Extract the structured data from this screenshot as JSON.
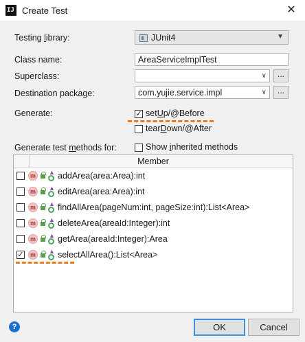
{
  "window": {
    "title": "Create Test",
    "app_icon_text": "IJ",
    "close_glyph": "✕"
  },
  "form": {
    "testing_library_label": "Testing library:",
    "testing_library_value": "JUnit4",
    "class_name_label": "Class name:",
    "class_name_value": "AreaServiceImplTest",
    "superclass_label": "Superclass:",
    "superclass_value": "",
    "destination_label": "Destination package:",
    "destination_value": "com.yujie.service.impl",
    "browse_label": "...",
    "generate_label": "Generate:",
    "setup_label": "setUp/@Before",
    "setup_checked": true,
    "teardown_label": "tearDown/@After",
    "teardown_checked": false,
    "generate_methods_label": "Generate test methods for:",
    "show_inherited_label": "Show inherited methods",
    "show_inherited_checked": false
  },
  "members": {
    "header": "Member",
    "icon_letter": "m",
    "rows": [
      {
        "name": "addArea(area:Area):int",
        "checked": false
      },
      {
        "name": "editArea(area:Area):int",
        "checked": false
      },
      {
        "name": "findAllArea(pageNum:int, pageSize:int):List<Area>",
        "checked": false
      },
      {
        "name": "deleteArea(areaId:Integer):int",
        "checked": false
      },
      {
        "name": "getArea(areaId:Integer):Area",
        "checked": false
      },
      {
        "name": "selectAllArea():List<Area>",
        "checked": true
      }
    ]
  },
  "footer": {
    "help_glyph": "?",
    "ok_label": "OK",
    "cancel_label": "Cancel"
  },
  "colors": {
    "annotation_dash": "#e87b1e",
    "ok_focus_border": "#3c8ee0",
    "help_icon": "#1f6fd1"
  }
}
